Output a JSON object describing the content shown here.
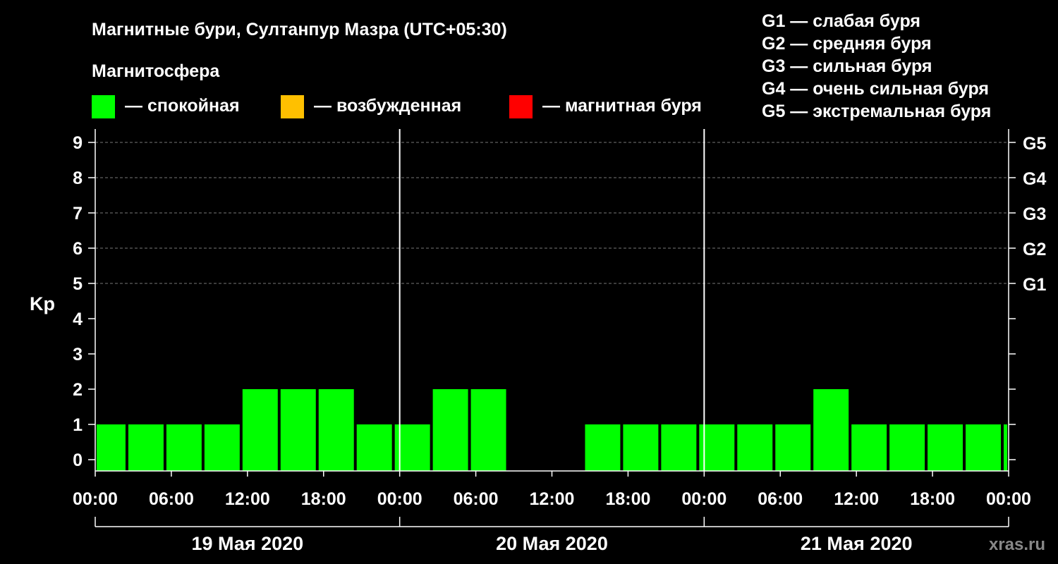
{
  "chart_data": {
    "type": "bar",
    "title": "Магнитные бури, Султанпур Мазра (UTC+05:30)",
    "ylabel": "Kp",
    "ylim": [
      0,
      9
    ],
    "yticks": [
      "0",
      "1",
      "2",
      "3",
      "4",
      "5",
      "6",
      "7",
      "8",
      "9"
    ],
    "right_ticks": [
      {
        "kp": 5,
        "label": "G1"
      },
      {
        "kp": 6,
        "label": "G2"
      },
      {
        "kp": 7,
        "label": "G3"
      },
      {
        "kp": 8,
        "label": "G4"
      },
      {
        "kp": 9,
        "label": "G5"
      }
    ],
    "magnetosphere_title": "Магнитосфера",
    "legend": [
      {
        "color": "#00ff00",
        "label": "— спокойная"
      },
      {
        "color": "#ffc000",
        "label": "— возбужденная"
      },
      {
        "color": "#ff0000",
        "label": "— магнитная буря"
      }
    ],
    "g_legend": [
      "G1 — слабая буря",
      "G2 — средняя буря",
      "G3 — сильная буря",
      "G4 — очень сильная буря",
      "G5 — экстремальная буря"
    ],
    "xticks": [
      "00:00",
      "06:00",
      "12:00",
      "18:00",
      "00:00",
      "06:00",
      "12:00",
      "18:00",
      "00:00",
      "06:00",
      "12:00",
      "18:00",
      "00:00"
    ],
    "days": [
      "19 Мая 2020",
      "20 Мая 2020",
      "21 Мая 2020"
    ],
    "x_start_hour": 0,
    "x_end_hour": 72,
    "bar_color": "#00ff00",
    "bars": [
      {
        "start": 0,
        "end": 2.5,
        "kp": 1
      },
      {
        "start": 2.5,
        "end": 5.5,
        "kp": 1
      },
      {
        "start": 5.5,
        "end": 8.5,
        "kp": 1
      },
      {
        "start": 8.5,
        "end": 11.5,
        "kp": 1
      },
      {
        "start": 11.5,
        "end": 14.5,
        "kp": 2
      },
      {
        "start": 14.5,
        "end": 17.5,
        "kp": 2
      },
      {
        "start": 17.5,
        "end": 20.5,
        "kp": 2
      },
      {
        "start": 20.5,
        "end": 23.5,
        "kp": 1
      },
      {
        "start": 23.5,
        "end": 26.5,
        "kp": 1
      },
      {
        "start": 26.5,
        "end": 29.5,
        "kp": 2
      },
      {
        "start": 29.5,
        "end": 32.5,
        "kp": 2
      },
      {
        "start": 32.5,
        "end": 35.5,
        "kp": 0
      },
      {
        "start": 35.5,
        "end": 38.5,
        "kp": 0
      },
      {
        "start": 38.5,
        "end": 41.5,
        "kp": 1
      },
      {
        "start": 41.5,
        "end": 44.5,
        "kp": 1
      },
      {
        "start": 44.5,
        "end": 47.5,
        "kp": 1
      },
      {
        "start": 47.5,
        "end": 50.5,
        "kp": 1
      },
      {
        "start": 50.5,
        "end": 53.5,
        "kp": 1
      },
      {
        "start": 53.5,
        "end": 56.5,
        "kp": 1
      },
      {
        "start": 56.5,
        "end": 59.5,
        "kp": 2
      },
      {
        "start": 59.5,
        "end": 62.5,
        "kp": 1
      },
      {
        "start": 62.5,
        "end": 65.5,
        "kp": 1
      },
      {
        "start": 65.5,
        "end": 68.5,
        "kp": 1
      },
      {
        "start": 68.5,
        "end": 71.5,
        "kp": 1
      },
      {
        "start": 71.5,
        "end": 72,
        "kp": 1
      }
    ],
    "grid": true,
    "legend_placement": "top"
  },
  "watermark": "xras.ru"
}
